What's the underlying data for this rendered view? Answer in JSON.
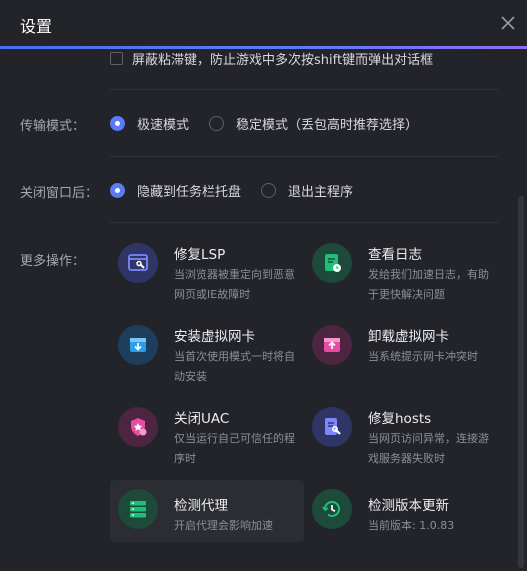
{
  "window": {
    "title": "设置"
  },
  "options": {
    "sticky_keys_label": "屏蔽粘滞键，防止游戏中多次按shift键而弹出对话框"
  },
  "transfer": {
    "label": "传输模式：",
    "options": [
      {
        "label": "极速模式",
        "selected": true
      },
      {
        "label": "稳定模式（丢包高时推荐选择）",
        "selected": false
      }
    ]
  },
  "close_window": {
    "label": "关闭窗口后：",
    "options": [
      {
        "label": "隐藏到任务栏托盘",
        "selected": true
      },
      {
        "label": "退出主程序",
        "selected": false
      }
    ]
  },
  "more_ops": {
    "label": "更多操作：",
    "items": [
      {
        "title": "修复LSP",
        "desc": "当浏览器被重定向到恶意网页或IE故障时",
        "icon": "browser-repair-icon",
        "color": "#5b63e6"
      },
      {
        "title": "查看日志",
        "desc": "发给我们加速日志，有助于更快解决问题",
        "icon": "log-icon",
        "color": "#1fbf7a"
      },
      {
        "title": "安装虚拟网卡",
        "desc": "当首次使用模式一时将自动安装",
        "icon": "install-card-icon",
        "color": "#2a9fe8"
      },
      {
        "title": "卸载虚拟网卡",
        "desc": "当系统提示网卡冲突时",
        "icon": "uninstall-card-icon",
        "color": "#e84aa5"
      },
      {
        "title": "关闭UAC",
        "desc": "仅当运行自己可信任的程序时",
        "icon": "shield-icon",
        "color": "#e84aa5"
      },
      {
        "title": "修复hosts",
        "desc": "当网页访问异常，连接游戏服务器失败时",
        "icon": "hosts-repair-icon",
        "color": "#6366f1"
      },
      {
        "title": "检测代理",
        "desc": "开启代理会影响加速",
        "icon": "proxy-server-icon",
        "color": "#1fbf7a"
      },
      {
        "title": "检测版本更新",
        "desc": "当前版本: 1.0.83",
        "icon": "update-icon",
        "color": "#1fbf7a"
      }
    ]
  }
}
